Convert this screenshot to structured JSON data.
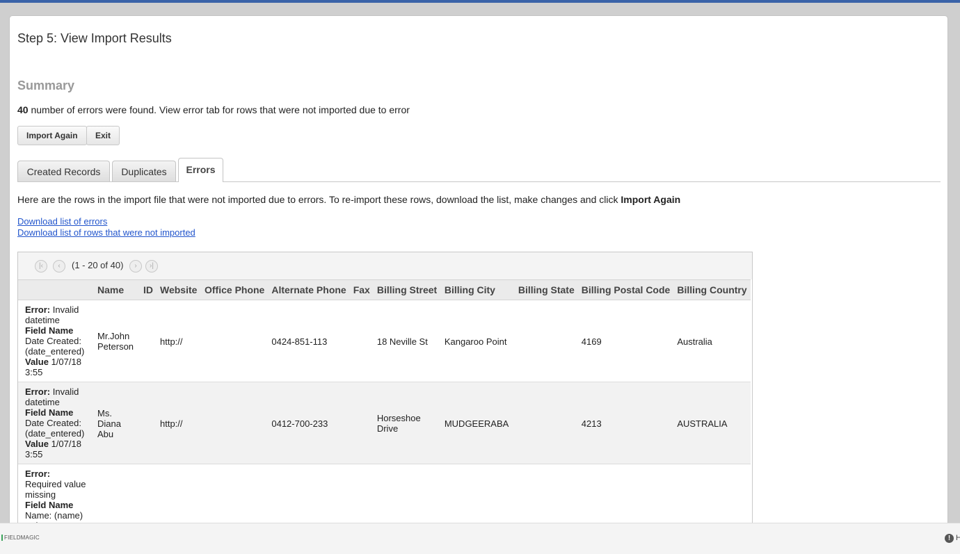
{
  "step_title": "Step 5: View Import Results",
  "summary": {
    "title": "Summary",
    "error_count": "40",
    "message": " number of errors were found. View error tab for rows that were not imported due to error"
  },
  "buttons": {
    "import_again": "Import Again",
    "exit": "Exit"
  },
  "tabs": [
    {
      "label": "Created Records"
    },
    {
      "label": "Duplicates"
    },
    {
      "label": "Errors",
      "active": true
    }
  ],
  "errors_tab": {
    "description": "Here are the rows in the import file that were not imported due to errors. To re-import these rows, download the list, make changes and click ",
    "description_bold": "Import Again",
    "links": {
      "download_errors": "Download list of errors",
      "download_rows": "Download list of rows that were not imported"
    }
  },
  "pager": {
    "range": "(1 - 20 of 40)"
  },
  "table": {
    "columns": [
      "",
      "Name",
      "ID",
      "Website",
      "Office Phone",
      "Alternate Phone",
      "Fax",
      "Billing Street",
      "Billing City",
      "Billing State",
      "Billing Postal Code",
      "Billing Country"
    ],
    "error_labels": {
      "error": "Error:",
      "field_name": "Field Name",
      "value": "Value"
    },
    "rows": [
      {
        "error": " Invalid datetime",
        "field": "Date Created: (date_entered)",
        "value": " 1/07/18 3:55",
        "name": "Mr.John Peterson",
        "id": "",
        "website": "http://",
        "office_phone": "",
        "alternate_phone": "0424-851-113",
        "fax": "",
        "billing_street": "18 Neville St",
        "billing_city": "Kangaroo Point",
        "billing_state": "",
        "billing_postal_code": "4169",
        "billing_country": "Australia"
      },
      {
        "error": " Invalid datetime",
        "field": "Date Created: (date_entered)",
        "value": " 1/07/18 3:55",
        "name": "Ms. Diana Abu",
        "id": "",
        "website": "http://",
        "office_phone": "",
        "alternate_phone": "0412-700-233",
        "fax": "",
        "billing_street": "Horseshoe Drive",
        "billing_city": "MUDGEERABA",
        "billing_state": "",
        "billing_postal_code": "4213",
        "billing_country": "AUSTRALIA"
      },
      {
        "error": " Required value missing",
        "field": "Name: (name)",
        "value": "",
        "name": "",
        "id": "",
        "website": "",
        "office_phone": "",
        "alternate_phone": "",
        "fax": "",
        "billing_street": "",
        "billing_city": "",
        "billing_state": "",
        "billing_postal_code": "",
        "billing_country": ""
      }
    ]
  },
  "footer": {
    "logo_text": "FIELDMAGIC",
    "help_text": "H"
  }
}
